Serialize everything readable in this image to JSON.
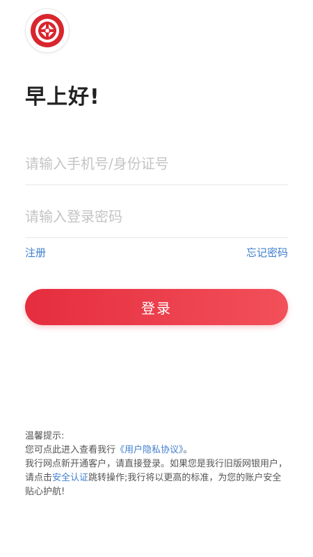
{
  "logo": {
    "icon": "bank-logo-icon",
    "color": "#d9262e"
  },
  "greeting": "早上好!",
  "form": {
    "phone_placeholder": "请输入手机号/身份证号",
    "password_placeholder": "请输入登录密码"
  },
  "links": {
    "register": "注册",
    "forgot_password": "忘记密码"
  },
  "login_button": "登录",
  "tips": {
    "title": "温馨提示:",
    "line1_prefix": "您可点此进入查看我行",
    "privacy_link": "《用户隐私协议》",
    "line1_suffix": "。",
    "para_prefix": "我行网点新开通客户，请直接登录。如果您是我行旧版网银用户，请点击",
    "security_link": "安全认证",
    "para_suffix": "跳转操作;我行将以更高的标准，为您的账户安全贴心护航!"
  },
  "colors": {
    "accent": "#e52d3e",
    "link": "#3f7fcc"
  }
}
